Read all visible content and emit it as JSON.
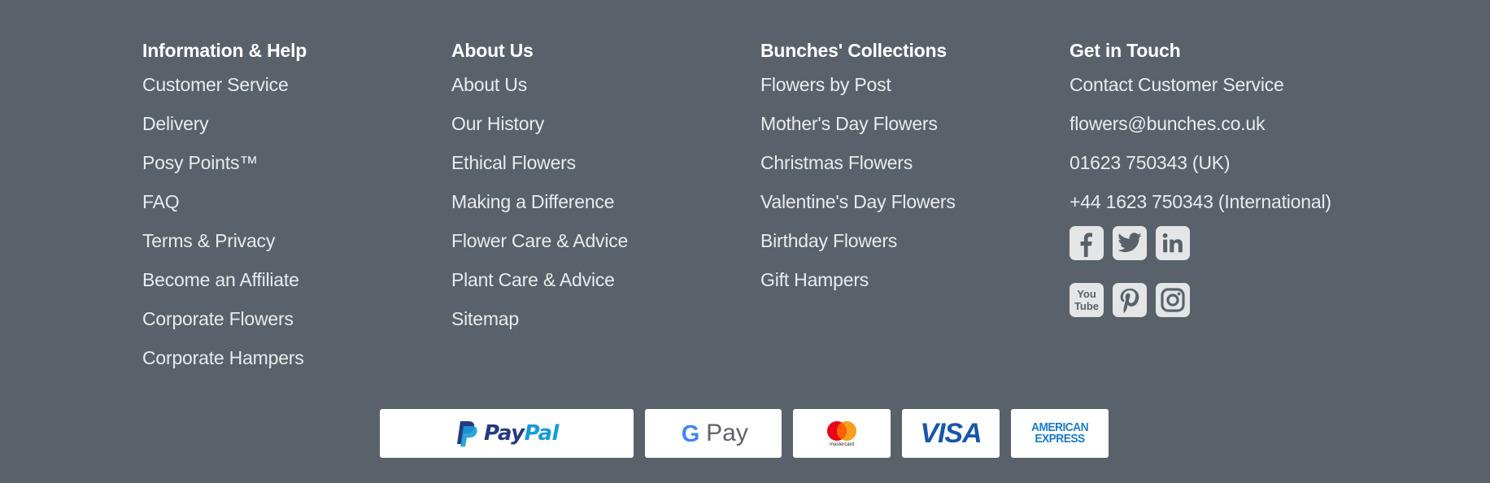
{
  "footer": {
    "columns": [
      {
        "heading": "Information & Help",
        "links": [
          "Customer Service",
          "Delivery",
          "Posy Points™",
          "FAQ",
          "Terms & Privacy",
          "Become an Affiliate",
          "Corporate Flowers",
          "Corporate Hampers"
        ]
      },
      {
        "heading": "About Us",
        "links": [
          "About Us",
          "Our History",
          "Ethical Flowers",
          "Making a Difference",
          "Flower Care & Advice",
          "Plant Care & Advice",
          "Sitemap"
        ]
      },
      {
        "heading": "Bunches' Collections",
        "links": [
          "Flowers by Post",
          "Mother's Day Flowers",
          "Christmas Flowers",
          "Valentine's Day Flowers",
          "Birthday Flowers",
          "Gift Hampers"
        ]
      },
      {
        "heading": "Get in Touch",
        "links": [
          "Contact Customer Service",
          "flowers@bunches.co.uk",
          "01623 750343 (UK)",
          "+44 1623 750343 (International)"
        ]
      }
    ],
    "social": [
      "facebook-icon",
      "twitter-icon",
      "linkedin-icon",
      "youtube-icon",
      "pinterest-icon",
      "instagram-icon"
    ],
    "social_labels": {
      "youtube_top": "You",
      "youtube_bottom": "Tube"
    },
    "payments": {
      "paypal": {
        "pay": "Pay",
        "pal": "Pal"
      },
      "gpay": {
        "g": "G",
        "pay": "Pay"
      },
      "mastercard": "mastercard",
      "visa": "VISA",
      "amex": {
        "line1": "AMERICAN",
        "line2": "EXPRESS"
      }
    }
  },
  "colors": {
    "background": "#59626a",
    "text": "#eef0f1",
    "social_tile": "#e3e5e7",
    "paypal_dark": "#253b80",
    "paypal_light": "#179bd7",
    "visa_blue": "#1a56a8",
    "amex_blue": "#1e7bc6",
    "mc_red": "#eb001b",
    "mc_yellow": "#f79e1b"
  }
}
